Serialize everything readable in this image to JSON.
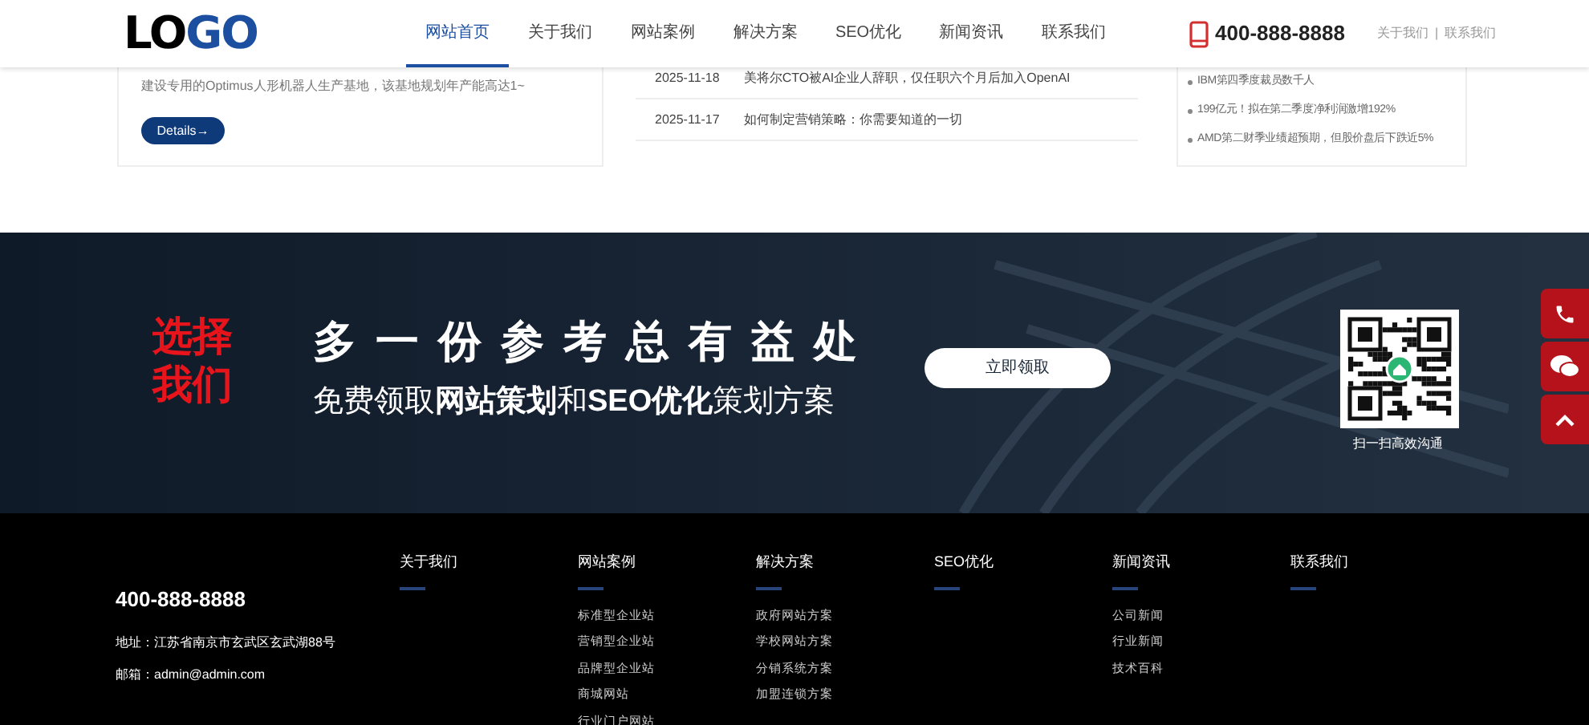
{
  "header": {
    "logo": [
      "LO",
      "GO"
    ],
    "nav": [
      {
        "label": "网站首页",
        "selected": true
      },
      {
        "label": "关于我们",
        "selected": false
      },
      {
        "label": "网站案例",
        "selected": false
      },
      {
        "label": "解决方案",
        "selected": false
      },
      {
        "label": "SEO优化",
        "selected": false
      },
      {
        "label": "新闻资讯",
        "selected": false
      },
      {
        "label": "联系我们",
        "selected": false
      }
    ],
    "phone": "400-888-8888",
    "links": [
      "关于我们",
      "联系我们"
    ],
    "separator": "|"
  },
  "featured": {
    "excerpt": "建设专用的Optimus人形机器人生产基地，该基地规划年产能高达1~",
    "button": "Details→"
  },
  "news": [
    {
      "date": "2025-11-18",
      "title": "美将尔CTO被AI企业人辞职，仅任职六个月后加入OpenAI"
    },
    {
      "date": "2025-11-17",
      "title": "如何制定营销策略：你需要知道的一切"
    }
  ],
  "headlines": [
    "IBM第四季度裁员数千人",
    "199亿元！拟在第二季度净利润激增192%",
    "AMD第二财季业绩超预期，但股价盘后下跌近5%"
  ],
  "banner": {
    "tag": [
      "选择",
      "我们"
    ],
    "heading": "多一份参考总有益处",
    "subheading": "免费领取**网站策划**和**SEO优化**策划方案",
    "button": "立即领取",
    "qr_caption": "扫一扫高效沟通"
  },
  "footer": {
    "phone": "400-888-8888",
    "address": "地址：江苏省南京市玄武区玄武湖88号",
    "email": "邮箱：admin@admin.com",
    "columns": [
      {
        "title": "关于我们"
      },
      {
        "title": "网站案例",
        "items": [
          "标准型企业站",
          "营销型企业站",
          "品牌型企业站",
          "商城网站",
          "行业门户网站"
        ]
      },
      {
        "title": "解决方案",
        "items": [
          "政府网站方案",
          "学校网站方案",
          "分销系统方案",
          "加盟连锁方案"
        ]
      },
      {
        "title": "SEO优化"
      },
      {
        "title": "新闻资讯",
        "items": [
          "公司新闻",
          "行业新闻",
          "技术百科"
        ]
      },
      {
        "title": "联系我们"
      }
    ]
  }
}
